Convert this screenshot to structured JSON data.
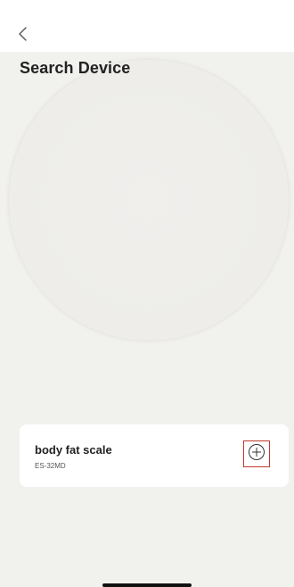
{
  "nav": {
    "back_icon": "chevron-left-icon"
  },
  "page": {
    "title": "Search Device"
  },
  "device": {
    "name": "body fat scale",
    "model": "ES-32MD",
    "add_icon": "plus-circle-icon",
    "add_highlight_color": "#c0392b"
  },
  "colors": {
    "content_background": "#f1f1ee",
    "card_background": "#ffffff",
    "text_primary": "#222222"
  }
}
